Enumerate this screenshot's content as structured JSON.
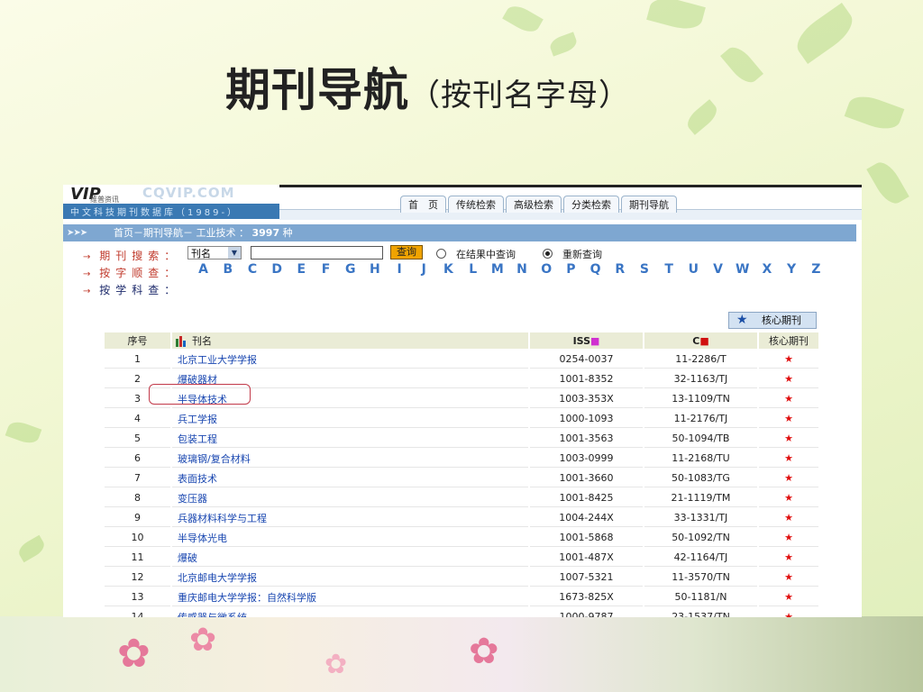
{
  "slide": {
    "title": "期刊导航",
    "subtitle": "（按刊名字母）"
  },
  "site": {
    "logo_mark": "VIP",
    "logo_small": "维普资讯",
    "logo_url": "CQVIP.COM",
    "logo_db": "中文科技期刊数据库（1989-）",
    "nav_tabs": [
      "首　页",
      "传统检索",
      "高级检索",
      "分类检索",
      "期刊导航"
    ]
  },
  "breadcrumb": {
    "arrows": "➤➤➤",
    "path": "首页－期刊导航－ 工业技术 ：",
    "count": "3997",
    "unit": "种"
  },
  "search": {
    "label": "期刊搜索：",
    "field_select": "刊名",
    "input_value": "",
    "query_button": "查询",
    "radio_in_results": "在结果中查询",
    "radio_new": "重新查询",
    "selected_radio": "new"
  },
  "alpha": {
    "label": "按字顺查：",
    "letters": [
      "A",
      "B",
      "C",
      "D",
      "E",
      "F",
      "G",
      "H",
      "I",
      "J",
      "K",
      "L",
      "M",
      "N",
      "O",
      "P",
      "Q",
      "R",
      "S",
      "T",
      "U",
      "V",
      "W",
      "X",
      "Y",
      "Z"
    ]
  },
  "subject": {
    "label": "按学科查："
  },
  "core_button": {
    "label": "核心期刊",
    "icon": "star-icon"
  },
  "table": {
    "headers": {
      "no": "序号",
      "name": "刊名",
      "issn": "ISS",
      "cn": "C",
      "core": "核心期刊"
    },
    "rows": [
      {
        "no": "1",
        "name": "北京工业大学学报",
        "issn": "0254-0037",
        "cn": "11-2286/T",
        "core": "★"
      },
      {
        "no": "2",
        "name": "爆破器材",
        "issn": "1001-8352",
        "cn": "32-1163/TJ",
        "core": "★"
      },
      {
        "no": "3",
        "name": "半导体技术",
        "issn": "1003-353X",
        "cn": "13-1109/TN",
        "core": "★"
      },
      {
        "no": "4",
        "name": "兵工学报",
        "issn": "1000-1093",
        "cn": "11-2176/TJ",
        "core": "★"
      },
      {
        "no": "5",
        "name": "包装工程",
        "issn": "1001-3563",
        "cn": "50-1094/TB",
        "core": "★"
      },
      {
        "no": "6",
        "name": "玻璃钢/复合材料",
        "issn": "1003-0999",
        "cn": "11-2168/TU",
        "core": "★"
      },
      {
        "no": "7",
        "name": "表面技术",
        "issn": "1001-3660",
        "cn": "50-1083/TG",
        "core": "★"
      },
      {
        "no": "8",
        "name": "变压器",
        "issn": "1001-8425",
        "cn": "21-1119/TM",
        "core": "★"
      },
      {
        "no": "9",
        "name": "兵器材料科学与工程",
        "issn": "1004-244X",
        "cn": "33-1331/TJ",
        "core": "★"
      },
      {
        "no": "10",
        "name": "半导体光电",
        "issn": "1001-5868",
        "cn": "50-1092/TN",
        "core": "★"
      },
      {
        "no": "11",
        "name": "爆破",
        "issn": "1001-487X",
        "cn": "42-1164/TJ",
        "core": "★"
      },
      {
        "no": "12",
        "name": "北京邮电大学学报",
        "issn": "1007-5321",
        "cn": "11-3570/TN",
        "core": "★"
      },
      {
        "no": "13",
        "name": "重庆邮电大学学报：自然科学版",
        "issn": "1673-825X",
        "cn": "50-1181/N",
        "core": "★"
      },
      {
        "no": "14",
        "name": "传感器与微系统",
        "issn": "1000-9787",
        "cn": "23-1537/TN",
        "core": "★"
      }
    ]
  },
  "colors": {
    "breadcrumb_bar": "#7ea7d1",
    "link_blue": "#1846b0",
    "letter_blue": "#3a75c4",
    "core_star_red": "#e01010",
    "query_button": "#f0a300"
  }
}
